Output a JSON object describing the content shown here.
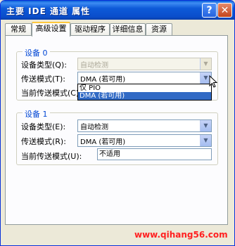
{
  "window": {
    "title": "主要 IDE 通道 属性",
    "help": "?",
    "close": "✕"
  },
  "tabs": [
    {
      "label": "常规"
    },
    {
      "label": "高级设置"
    },
    {
      "label": "驱动程序"
    },
    {
      "label": "详细信息"
    },
    {
      "label": "资源"
    }
  ],
  "device0": {
    "legend": "设备 0",
    "type_label": "设备类型(Q):",
    "type_value": "自动检测",
    "mode_label": "传送模式(T):",
    "mode_value": "DMA (若可用)",
    "current_label": "当前传送模式(C):",
    "dropdown_options": [
      "仅 PIO",
      "DMA (若可用)"
    ],
    "selected_option": "DMA (若可用)"
  },
  "device1": {
    "legend": "设备 1",
    "type_label": "设备类型(E):",
    "type_value": "自动检测",
    "mode_label": "传送模式(R):",
    "mode_value": "DMA (若可用)",
    "current_label": "当前传送模式(U):",
    "current_value": "不适用"
  },
  "watermark": "www.qihang56.com",
  "colors": {
    "title_bar": "#0a4ecb",
    "legend_text": "#0046d5",
    "selection": "#316ac5",
    "tab_highlight": "#ffc83c"
  },
  "icons": {
    "dropdown": "chevron-down-icon",
    "cursor": "mouse-pointer-icon"
  }
}
